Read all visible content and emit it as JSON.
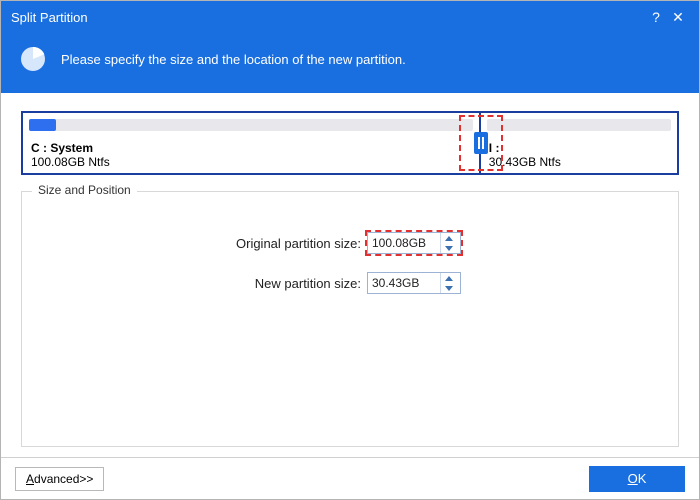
{
  "title": "Split Partition",
  "instruction": "Please specify the size and the location of the new partition.",
  "partitions": {
    "left": {
      "name": "C : System",
      "info": "100.08GB Ntfs",
      "width_pct": 70,
      "used_pct": 6
    },
    "right": {
      "name": "I :",
      "info": "30.43GB Ntfs",
      "width_pct": 30,
      "used_pct": 0
    }
  },
  "fieldset_legend": "Size and Position",
  "fields": {
    "original": {
      "label": "Original partition size:",
      "value": "100.08GB",
      "highlight": true
    },
    "new": {
      "label": "New partition size:",
      "value": "30.43GB",
      "highlight": false
    }
  },
  "footer": {
    "advanced": "Advanced>>",
    "ok": "OK"
  }
}
